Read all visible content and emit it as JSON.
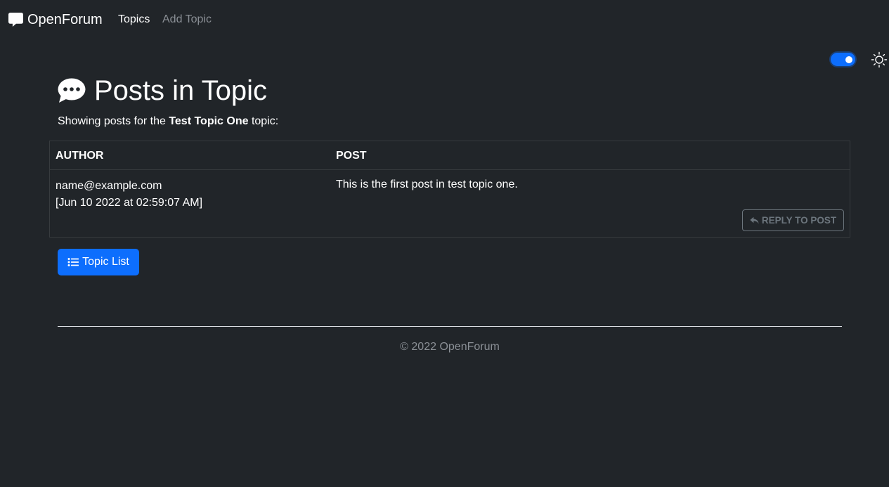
{
  "navbar": {
    "brand": "OpenForum",
    "brand_icon": "chat-square-icon",
    "links": [
      "Topics",
      "Add Topic"
    ]
  },
  "theme": {
    "toggle_on": true,
    "icon": "sun-icon",
    "accent": "#0d6efd"
  },
  "page": {
    "title": "Posts in Topic",
    "title_icon": "chat-dots-icon",
    "subtitle_prefix": "Showing posts for the ",
    "topic_name": "Test Topic One",
    "subtitle_suffix": " topic:"
  },
  "table": {
    "headers": [
      "AUTHOR",
      "POST"
    ],
    "rows": [
      {
        "author": "name@example.com",
        "timestamp": "[Jun 10 2022 at 02:59:07 AM]",
        "post": "This is the first post in test topic one.",
        "reply_label": "REPLY TO POST"
      }
    ]
  },
  "actions": {
    "topic_list_label": "Topic List"
  },
  "footer": {
    "text": "© 2022 OpenForum"
  },
  "colors": {
    "background": "#212529",
    "primary": "#0d6efd",
    "muted": "#8a8f95",
    "border": "#373b3e"
  }
}
